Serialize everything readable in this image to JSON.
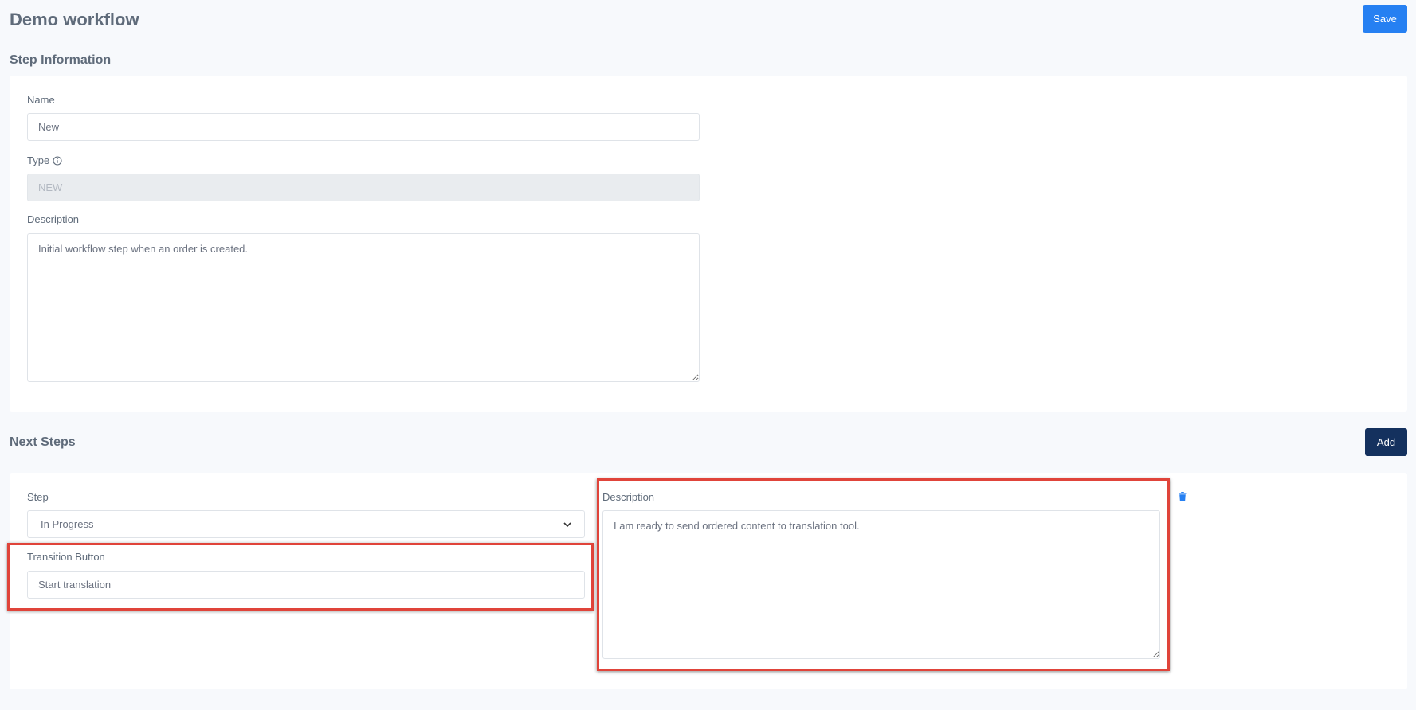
{
  "header": {
    "title": "Demo workflow",
    "save_label": "Save"
  },
  "step_information": {
    "section_title": "Step Information",
    "name_label": "Name",
    "name_value": "New",
    "type_label": "Type",
    "type_value": "NEW",
    "description_label": "Description",
    "description_value": "Initial workflow step when an order is created."
  },
  "next_steps": {
    "section_title": "Next Steps",
    "add_label": "Add",
    "items": [
      {
        "step_label": "Step",
        "step_value": "In Progress",
        "transition_label": "Transition Button",
        "transition_value": "Start translation",
        "description_label": "Description",
        "description_value": "I am ready to send ordered content to translation tool."
      }
    ]
  },
  "icons": {
    "type_info": "info-icon",
    "select_chevron": "chevron-down-icon",
    "delete": "trash-icon"
  },
  "colors": {
    "primary": "#2680f2",
    "dark_button": "#14315e",
    "highlight": "#e0443a",
    "delete_icon": "#2680f2"
  }
}
